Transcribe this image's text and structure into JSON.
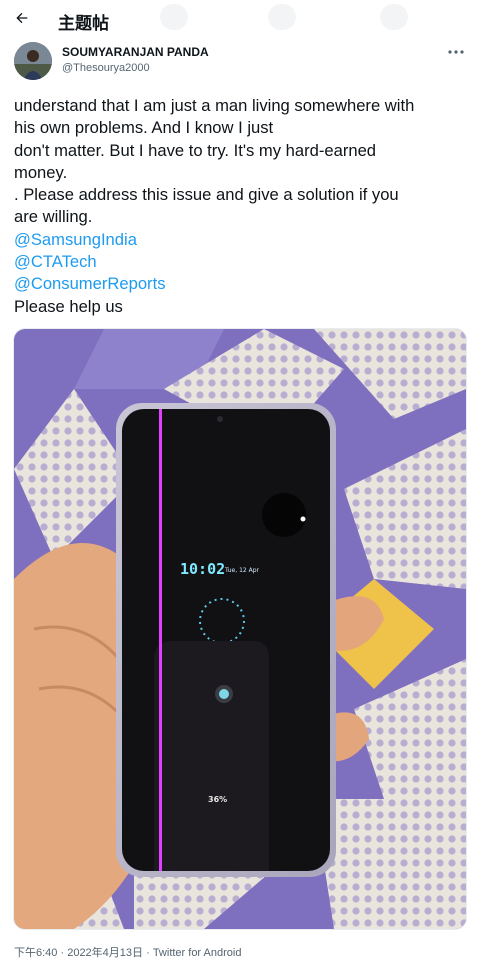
{
  "header": {
    "title": "主题帖",
    "back_icon": "arrow-left-icon"
  },
  "author": {
    "name": "SOUMYARANJAN PANDA",
    "handle": "@Thesourya2000",
    "more_icon": "more-horizontal-icon"
  },
  "tweet": {
    "lines": [
      "understand that I am just a man living somewhere with",
      "his own problems. And I know I just",
      "don't matter. But I have to try. It's my hard-earned",
      "money.",
      ". Please address this issue and give a solution if you",
      "are willing."
    ],
    "mentions": [
      "@SamsungIndia",
      "@CTATech",
      "@ConsumerReports"
    ],
    "closing": "Please help us"
  },
  "media": {
    "phone_time": "10:02",
    "phone_date": "Tue, 12 Apr",
    "phone_battery": "36%",
    "colors": {
      "defect_line": "#e040ff",
      "clock_cyan": "#7fe9ff"
    }
  },
  "meta": {
    "time": "下午6:40",
    "separator": " · ",
    "date": "2022年4月13日",
    "source": "Twitter for Android"
  }
}
